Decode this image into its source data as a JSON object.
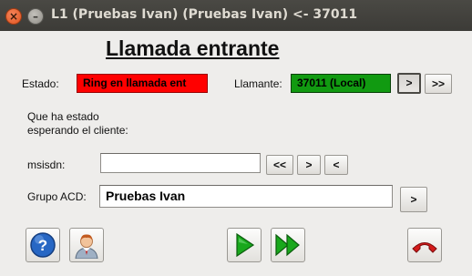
{
  "window": {
    "title": "L1 (Pruebas Ivan) (Pruebas Ivan) <- 37011",
    "close_glyph": "×",
    "minimize_glyph": "–"
  },
  "header": "Llamada entrante",
  "estado": {
    "label": "Estado:",
    "value": "Ring en llamada ent"
  },
  "llamante": {
    "label": "Llamante:",
    "value": "37011 (Local)",
    "btn_next": ">",
    "btn_skip": ">>"
  },
  "wait_text": {
    "line1": "Que ha estado",
    "line2": "esperando el cliente:"
  },
  "msisdn": {
    "label": "msisdn:",
    "value": "",
    "btn_first": "<<",
    "btn_next": ">",
    "btn_prev": "<"
  },
  "grupo_acd": {
    "label": "Grupo ACD:",
    "value": "Pruebas Ivan",
    "btn_next": ">"
  },
  "colors": {
    "estado_bg": "#ff0000",
    "llamante_bg": "#119a11",
    "play_green": "#19a81c",
    "hangup_red": "#d41a1a",
    "help_blue": "#2767c4"
  },
  "toolbar": {
    "icons": [
      "help-icon",
      "user-icon",
      "play-icon",
      "fast-forward-icon",
      "hangup-icon"
    ]
  }
}
